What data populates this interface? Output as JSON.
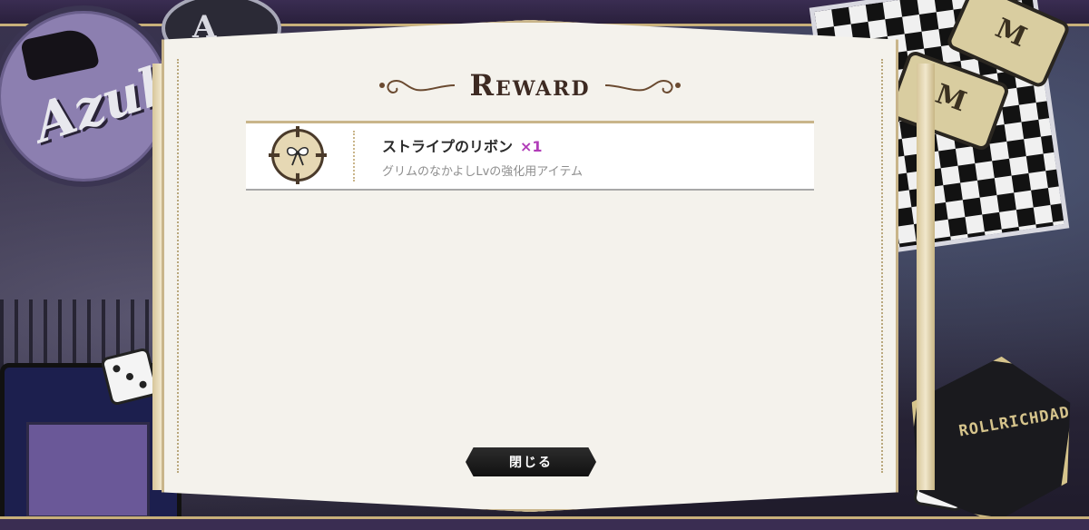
{
  "background": {
    "badge_left_text": "Azul",
    "badge_top_text": "A",
    "tag_letter": "M",
    "gem_badge_text": "ROLLRICHDAD"
  },
  "dialog": {
    "title": "Reward",
    "items": [
      {
        "icon": "ribbon-icon",
        "name": "ストライプのリボン",
        "quantity": "×1",
        "description": "グリムのなかよしLvの強化用アイテム"
      }
    ],
    "close_label": "閉じる"
  },
  "colors": {
    "accent_gold": "#c9b58a",
    "quantity_purple": "#b13cb8",
    "panel_bg": "#f4f2ec",
    "button_bg": "#111111"
  }
}
